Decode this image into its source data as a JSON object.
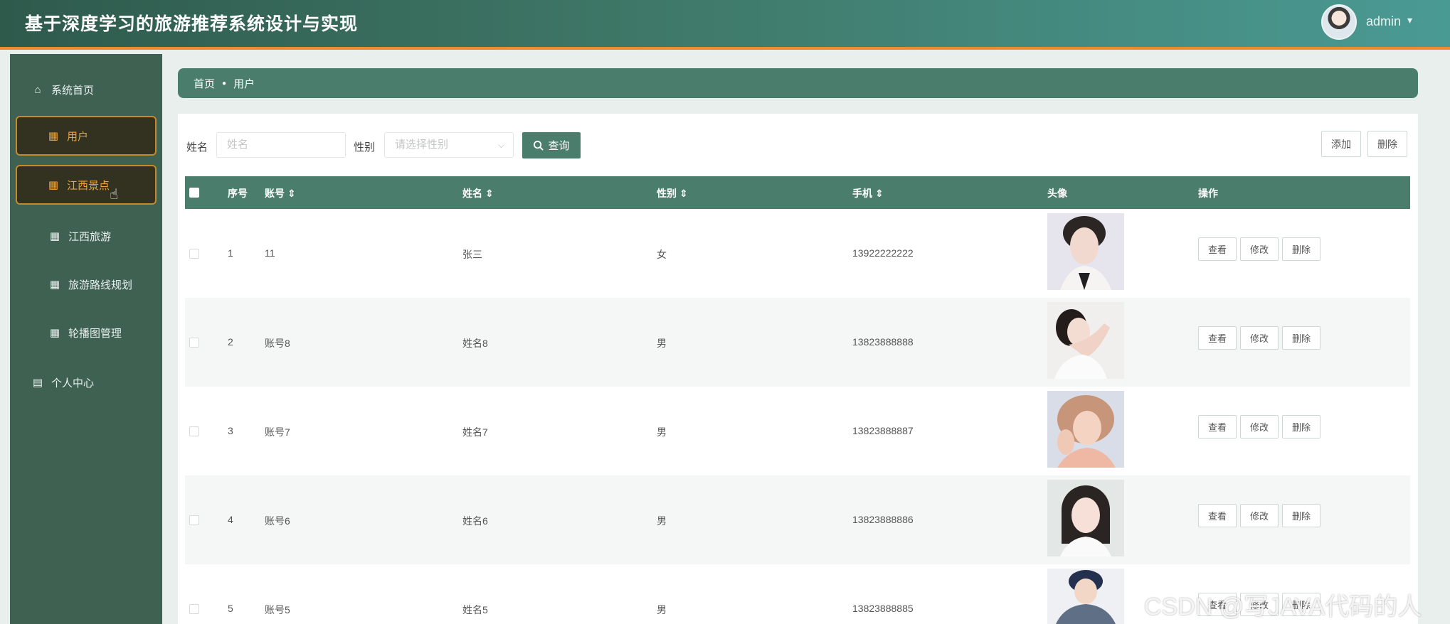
{
  "header": {
    "title": "基于深度学习的旅游推荐系统设计与实现",
    "user": "admin",
    "caret": "▾"
  },
  "sidebar": {
    "items": [
      {
        "label": "系统首页",
        "icon": "home-icon",
        "glyph": "⌂"
      },
      {
        "label": "用户",
        "icon": "grid-icon",
        "glyph": "▦"
      },
      {
        "label": "江西景点",
        "icon": "grid-icon",
        "glyph": "▦"
      },
      {
        "label": "江西旅游",
        "icon": "grid-icon",
        "glyph": "▦"
      },
      {
        "label": "旅游路线规划",
        "icon": "grid-icon",
        "glyph": "▦"
      },
      {
        "label": "轮播图管理",
        "icon": "grid-icon",
        "glyph": "▦"
      },
      {
        "label": "个人中心",
        "icon": "calendar-icon",
        "glyph": "▤"
      }
    ]
  },
  "breadcrumb": {
    "home": "首页",
    "current": "用户"
  },
  "search": {
    "name_label": "姓名",
    "name_placeholder": "姓名",
    "gender_label": "性别",
    "gender_placeholder": "请选择性别",
    "search_button": "查询",
    "search_icon": "search-icon"
  },
  "toolbar": {
    "add": "添加",
    "delete": "删除"
  },
  "table": {
    "headers": {
      "index": "序号",
      "account": "账号 ⇕",
      "name": "姓名 ⇕",
      "gender": "性别 ⇕",
      "phone": "手机 ⇕",
      "avatar": "头像",
      "actions": "操作"
    },
    "rows": [
      {
        "index": "1",
        "account": "11",
        "name": "张三",
        "gender": "女",
        "phone": "13922222222"
      },
      {
        "index": "2",
        "account": "账号8",
        "name": "姓名8",
        "gender": "男",
        "phone": "13823888888"
      },
      {
        "index": "3",
        "account": "账号7",
        "name": "姓名7",
        "gender": "男",
        "phone": "13823888887"
      },
      {
        "index": "4",
        "account": "账号6",
        "name": "姓名6",
        "gender": "男",
        "phone": "13823888886"
      },
      {
        "index": "5",
        "account": "账号5",
        "name": "姓名5",
        "gender": "男",
        "phone": "13823888885"
      }
    ],
    "row_actions": {
      "view": "查看",
      "edit": "修改",
      "delete": "删除"
    }
  },
  "watermark": "CSDN @写JAVA代码的人",
  "colors": {
    "primary": "#4b7d6d",
    "sidebar": "#3f6152",
    "accent": "#f08a2c"
  }
}
